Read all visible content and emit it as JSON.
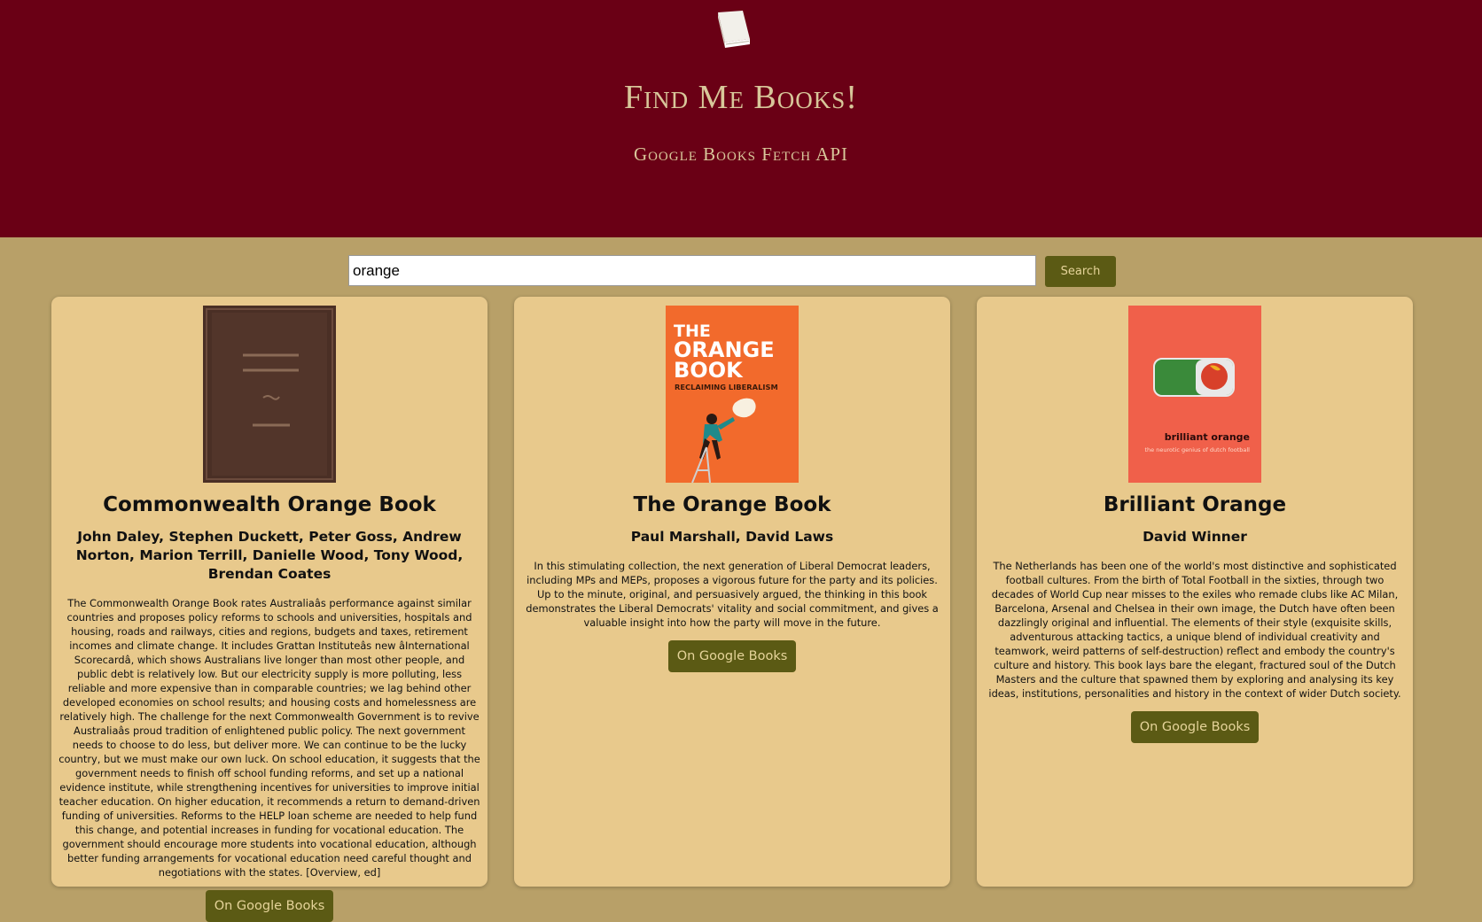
{
  "header": {
    "logo_icon": "book-icon",
    "title": "Find Me Books!",
    "subtitle": "Google Books Fetch API"
  },
  "search": {
    "value": "orange",
    "button_label": "Search"
  },
  "colors": {
    "header_bg": "#6a0015",
    "page_bg": "#b8a068",
    "card_bg": "#e8c98c",
    "button_bg": "#5b5a14",
    "button_text": "#e6d49a"
  },
  "books": [
    {
      "title": "Commonwealth Orange Book",
      "authors": "John Daley, Stephen Duckett, Peter Goss, Andrew Norton, Marion Terrill, Danielle Wood, Tony Wood, Brendan Coates",
      "description": "The Commonwealth Orange Book rates Australiaâs performance against similar countries and proposes policy reforms to schools and universities, hospitals and housing, roads and railways, cities and regions, budgets and taxes, retirement incomes and climate change. It includes Grattan Instituteâs new âInternational Scorecardâ, which shows Australians live longer than most other people, and public debt is relatively low. But our electricity supply is more polluting, less reliable and more expensive than in comparable countries; we lag behind other developed economies on school results; and housing costs and homelessness are relatively high. The challenge for the next Commonwealth Government is to revive Australiaâs proud tradition of enlightened public policy. The next government needs to choose to do less, but deliver more. We can continue to be the lucky country, but we must make our own luck. On school education, it suggests that the government needs to finish off school funding reforms, and set up a national evidence institute, while strengthening incentives for universities to improve initial teacher education. On higher education, it recommends a return to demand-driven funding of universities. Reforms to the HELP loan scheme are needed to help fund this change, and potential increases in funding for vocational education. The government should encourage more students into vocational education, although better funding arrangements for vocational education need careful thought and negotiations with the states. [Overview, ed]",
      "link_label": "On Google Books"
    },
    {
      "title": "The Orange Book",
      "authors": "Paul Marshall, David Laws",
      "description": "In this stimulating collection, the next generation of Liberal Democrat leaders, including MPs and MEPs, proposes a vigorous future for the party and its policies. Up to the minute, original, and persuasively argued, the thinking in this book demonstrates the Liberal Democrats' vitality and social commitment, and gives a valuable insight into how the party will move in the future.",
      "link_label": "On Google Books",
      "cover_text": [
        "THE",
        "ORANGE",
        "BOOK",
        "RECLAIMING LIBERALISM"
      ]
    },
    {
      "title": "Brilliant Orange",
      "authors": "David Winner",
      "description": "The Netherlands has been one of the world's most distinctive and sophisticated football cultures. From the birth of Total Football in the sixties, through two decades of World Cup near misses to the exiles who remade clubs like AC Milan, Barcelona, Arsenal and Chelsea in their own image, the Dutch have often been dazzlingly original and influential. The elements of their style (exquisite skills, adventurous attacking tactics, a unique blend of individual creativity and teamwork, weird patterns of self-destruction) reflect and embody the country's culture and history. This book lays bare the elegant, fractured soul of the Dutch Masters and the culture that spawned them by exploring and analysing its key ideas, institutions, personalities and history in the context of wider Dutch society.",
      "link_label": "On Google Books",
      "cover_text": [
        "brilliant orange",
        "the neurotic genius of dutch football"
      ]
    }
  ]
}
